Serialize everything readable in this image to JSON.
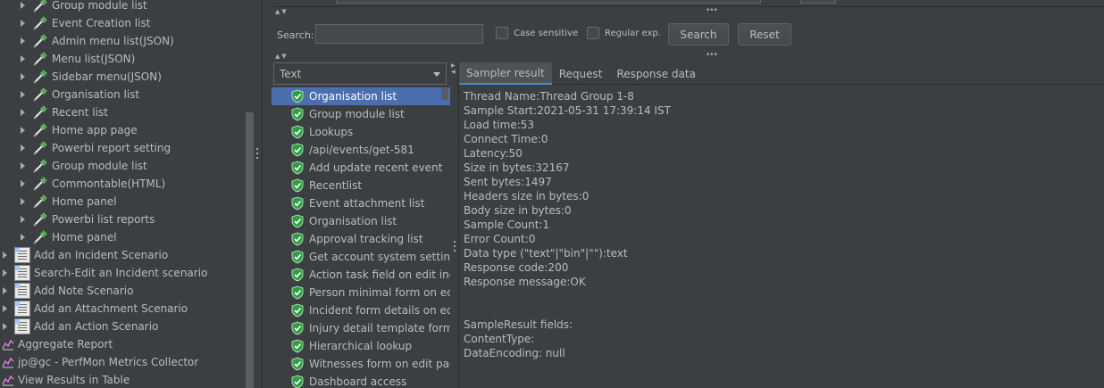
{
  "tree": {
    "samplers": [
      "Group module list",
      "Event Creation list",
      "Admin menu list(JSON)",
      "Menu list(JSON)",
      "Sidebar menu(JSON)",
      "Organisation list",
      "Recent list",
      "Home app page",
      "Powerbi report setting",
      "Group module list",
      "Commontable(HTML)",
      "Home panel",
      "Powerbi list reports",
      "Home panel"
    ],
    "scenarios": [
      "Add an Incident Scenario",
      "Search-Edit an Incident scenario",
      "Add Note Scenario",
      "Add an Attachment Scenario",
      "Add an Action Scenario"
    ],
    "listeners": [
      "Aggregate Report",
      "jp@gc - PerfMon Metrics Collector",
      "View Results in Table"
    ]
  },
  "search": {
    "label": "Search:",
    "value": "",
    "case_sensitive_label": "Case sensitive",
    "regex_label": "Regular exp.",
    "search_button": "Search",
    "reset_button": "Reset"
  },
  "renderer": {
    "selected": "Text"
  },
  "results": [
    "Organisation list",
    "Group module list",
    "Lookups",
    "/api/events/get-581",
    "Add update recent event",
    "Recentlist",
    "Event attachment list",
    "Organisation list",
    "Approval tracking list",
    "Get account system setting",
    "Action task field on edit inci",
    "Person minimal form on ec",
    "Incident form details on edi",
    "Injury detail template form d",
    "Hierarchical lookup",
    "Witnesses form on edit pag",
    "Dashboard access"
  ],
  "tabs": [
    "Sampler result",
    "Request",
    "Response data"
  ],
  "detail_lines": [
    "Thread Name:Thread Group 1-8",
    "Sample Start:2021-05-31 17:39:14 IST",
    "Load time:53",
    "Connect Time:0",
    "Latency:50",
    "Size in bytes:32167",
    "Sent bytes:1497",
    "Headers size in bytes:0",
    "Body size in bytes:0",
    "Sample Count:1",
    "Error Count:0",
    "Data type (\"text\"|\"bin\"|\"\"):text",
    "Response code:200",
    "Response message:OK",
    "",
    "",
    "SampleResult fields:",
    "ContentType:",
    "DataEncoding: null"
  ],
  "colors": {
    "background": "#3c3f41",
    "selection": "#4b6eaf",
    "success_green": "#2ea043",
    "pipette_green": "#5fb85c"
  }
}
